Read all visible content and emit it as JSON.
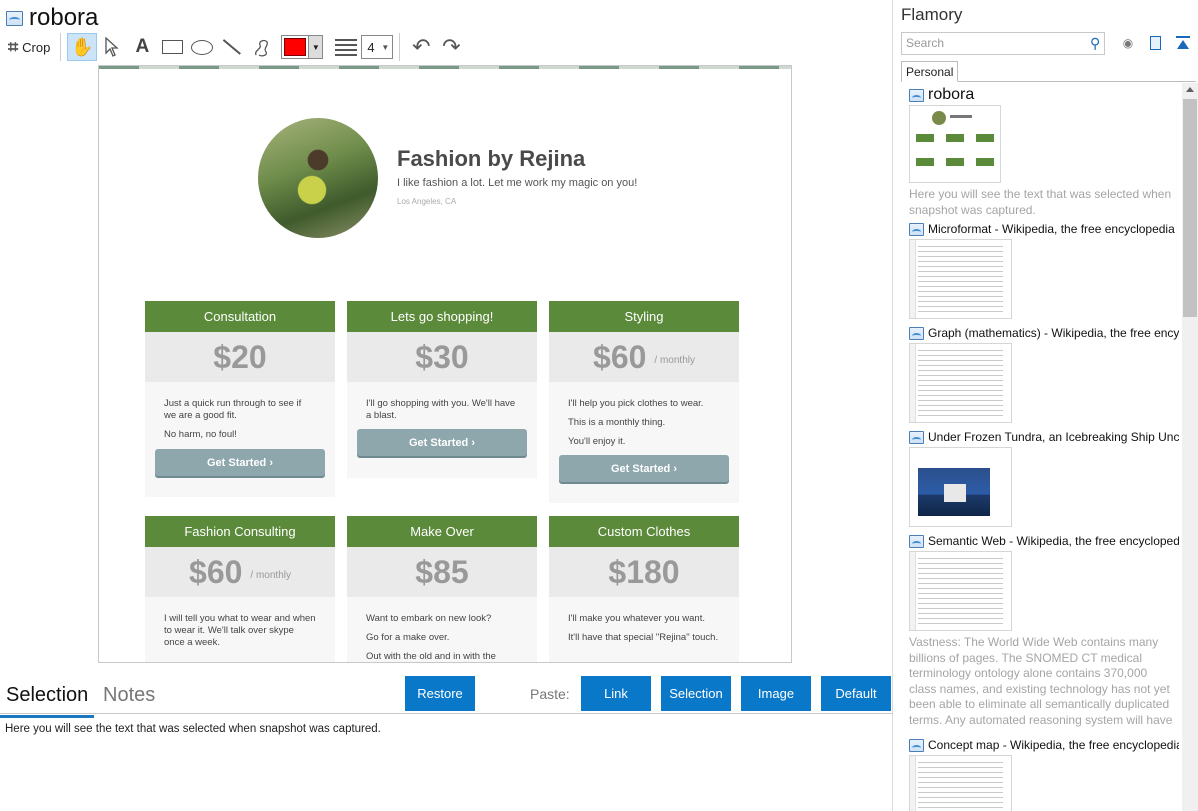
{
  "document": {
    "title": "robora"
  },
  "toolbar": {
    "crop_label": "Crop",
    "stroke_width": "4",
    "colors": {
      "active_stroke": "#ff0000",
      "hand_active_bg": "#cce4f7"
    },
    "icons": [
      "crop-icon",
      "hand-icon",
      "pointer-icon",
      "text-icon",
      "rectangle-icon",
      "ellipse-icon",
      "line-icon",
      "freehand-icon",
      "color-picker",
      "line-width-icon",
      "undo-icon",
      "redo-icon"
    ]
  },
  "canvas": {
    "profile_name": "Fashion by Rejina",
    "profile_tagline": "I like fashion a lot. Let me work my magic on you!",
    "profile_location": "Los Angeles, CA",
    "cards": [
      {
        "title": "Consultation",
        "price": "$20",
        "period": "",
        "lines": [
          "Just a quick run through to see if we are a good fit.",
          "No harm, no foul!"
        ],
        "button": "Get Started ›"
      },
      {
        "title": "Lets go shopping!",
        "price": "$30",
        "period": "",
        "lines": [
          "I'll go shopping with you. We'll have a blast."
        ],
        "button": "Get Started ›"
      },
      {
        "title": "Styling",
        "price": "$60",
        "period": "/ monthly",
        "lines": [
          "I'll help you pick clothes to wear.",
          "This is a monthly thing.",
          "You'll enjoy it."
        ],
        "button": "Get Started ›"
      },
      {
        "title": "Fashion Consulting",
        "price": "$60",
        "period": "/ monthly",
        "lines": [
          "I will tell you what to wear and when to wear it. We'll talk over skype once a week."
        ],
        "button": ""
      },
      {
        "title": "Make Over",
        "price": "$85",
        "period": "",
        "lines": [
          "Want to embark on new look?",
          "Go for a make over.",
          "Out with the old and in with the"
        ],
        "button": ""
      },
      {
        "title": "Custom Clothes",
        "price": "$180",
        "period": "",
        "lines": [
          "I'll make you whatever you want.",
          "It'll have that special \"Rejina\" touch."
        ],
        "button": ""
      }
    ],
    "colors": {
      "card_header": "#5b8a3a",
      "card_button": "#8da7ad"
    }
  },
  "bottom": {
    "tab_selection": "Selection",
    "tab_notes": "Notes",
    "restore_label": "Restore",
    "paste_label": "Paste:",
    "link_label": "Link",
    "selection_label": "Selection",
    "image_label": "Image",
    "default_label": "Default",
    "selection_text": "Here you will see the text that was selected when snapshot was captured.",
    "colors": {
      "button": "#0a78c8"
    }
  },
  "sidebar": {
    "app_title": "Flamory",
    "search_placeholder": "Search",
    "tab_personal": "Personal",
    "snapshots": [
      {
        "title": "robora",
        "desc": "Here you will see the text that was selected when snapshot was captured."
      },
      {
        "title": "Microformat - Wikipedia, the free encyclopedia",
        "desc": ""
      },
      {
        "title": "Graph (mathematics) - Wikipedia, the free encyclopedia",
        "desc": ""
      },
      {
        "title": "Under Frozen Tundra, an Icebreaking Ship Uncovers",
        "desc": ""
      },
      {
        "title": "Semantic Web - Wikipedia, the free encyclopedia",
        "desc": "Vastness: The World Wide Web contains many billions of pages. The SNOMED CT medical terminology ontology alone contains 370,000 class names, and existing technology has not yet been able to eliminate all semantically duplicated terms. Any automated reasoning system will have to deal with truly huge inputs."
      },
      {
        "title": "Concept map - Wikipedia, the free encyclopedia",
        "desc": ""
      }
    ]
  }
}
